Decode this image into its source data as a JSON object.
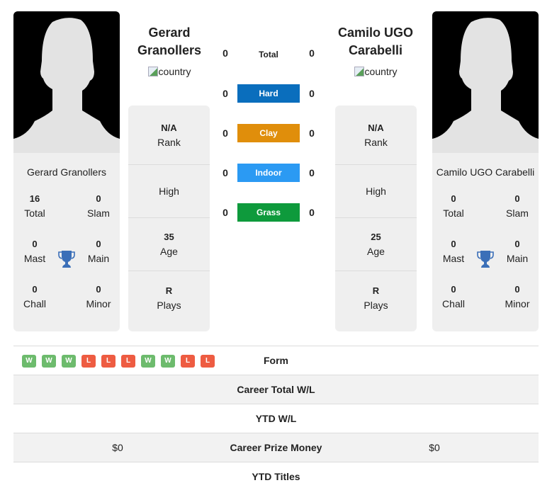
{
  "player1": {
    "name": "Gerard Granollers",
    "name_line1": "Gerard",
    "name_line2": "Granollers",
    "country_alt": "country",
    "rank": "N/A",
    "rank_label": "Rank",
    "high_label": "High",
    "age": "35",
    "age_label": "Age",
    "plays": "R",
    "plays_label": "Plays",
    "titles": {
      "total": "16",
      "total_label": "Total",
      "slam": "0",
      "slam_label": "Slam",
      "mast": "0",
      "mast_label": "Mast",
      "main": "0",
      "main_label": "Main",
      "chall": "0",
      "chall_label": "Chall",
      "minor": "0",
      "minor_label": "Minor"
    }
  },
  "player2": {
    "name": "Camilo UGO Carabelli",
    "name_line1": "Camilo UGO",
    "name_line2": "Carabelli",
    "country_alt": "country",
    "rank": "N/A",
    "rank_label": "Rank",
    "high_label": "High",
    "age": "25",
    "age_label": "Age",
    "plays": "R",
    "plays_label": "Plays",
    "titles": {
      "total": "0",
      "total_label": "Total",
      "slam": "0",
      "slam_label": "Slam",
      "mast": "0",
      "mast_label": "Mast",
      "main": "0",
      "main_label": "Main",
      "chall": "0",
      "chall_label": "Chall",
      "minor": "0",
      "minor_label": "Minor"
    }
  },
  "h2h": {
    "total": {
      "label": "Total",
      "p1": "0",
      "p2": "0"
    },
    "surfaces": [
      {
        "label": "Hard",
        "p1": "0",
        "p2": "0",
        "color": "#0a6ebd"
      },
      {
        "label": "Clay",
        "p1": "0",
        "p2": "0",
        "color": "#e08e0b"
      },
      {
        "label": "Indoor",
        "p1": "0",
        "p2": "0",
        "color": "#2b9af3"
      },
      {
        "label": "Grass",
        "p1": "0",
        "p2": "0",
        "color": "#0e9a3c"
      }
    ]
  },
  "form": {
    "label": "Form",
    "results": [
      "W",
      "W",
      "W",
      "L",
      "L",
      "L",
      "W",
      "W",
      "L",
      "L"
    ],
    "win_color": "#6dbb6d",
    "loss_color": "#ee5c42"
  },
  "rows": [
    {
      "label": "Career Total W/L",
      "p1": "",
      "p2": ""
    },
    {
      "label": "YTD W/L",
      "p1": "",
      "p2": ""
    },
    {
      "label": "Career Prize Money",
      "p1": "$0",
      "p2": "$0"
    },
    {
      "label": "YTD Titles",
      "p1": "",
      "p2": ""
    }
  ],
  "trophy_color": "#3b6fb8"
}
